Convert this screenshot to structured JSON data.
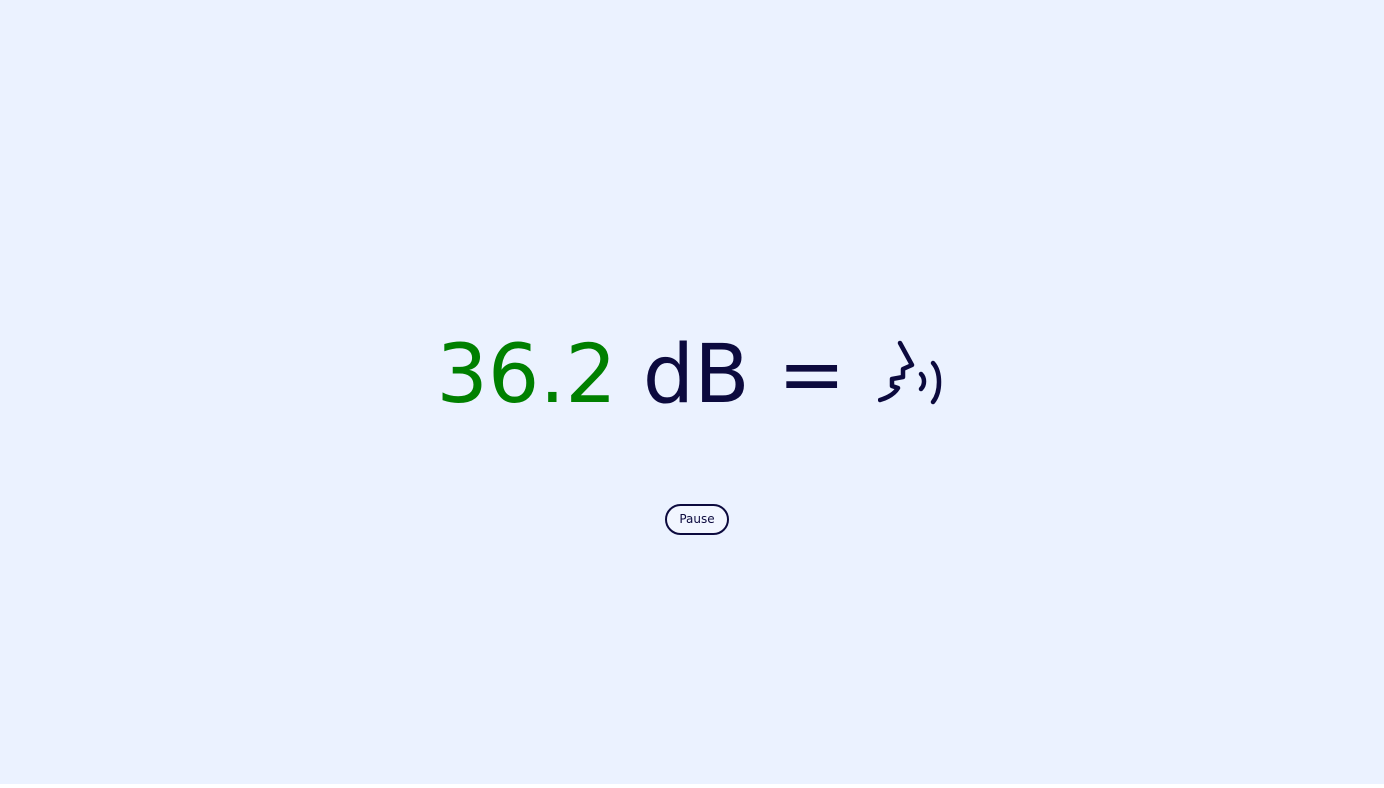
{
  "meter": {
    "value": "36.2",
    "unit": "dB",
    "equals": "=",
    "level_icon": "speaking-head-icon",
    "value_color": "#008000",
    "text_color": "#0c0a3e"
  },
  "controls": {
    "pause_label": "Pause"
  },
  "colors": {
    "background": "#ebf2ff"
  }
}
